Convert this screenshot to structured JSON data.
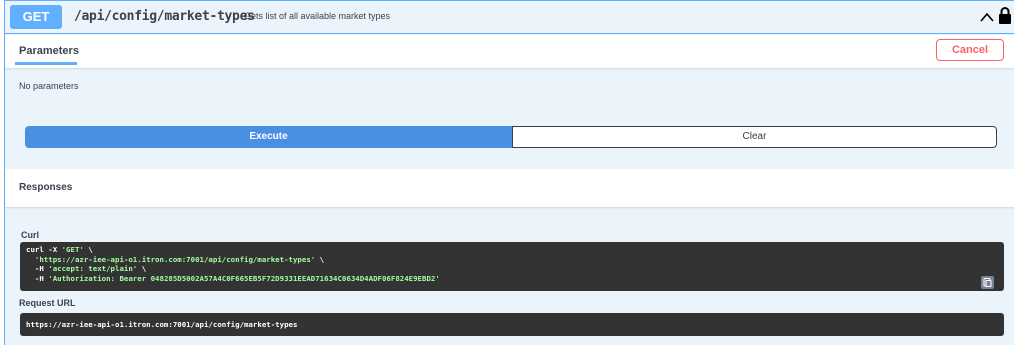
{
  "operation": {
    "method": "GET",
    "path": "/api/config/market-types",
    "description": "Gets list of all available market types",
    "colors": {
      "accent": "#61affe",
      "background": "#ebf3fb",
      "cancel": "#ff6060",
      "execute": "#4990e2"
    }
  },
  "parameters": {
    "tab_label": "Parameters",
    "cancel_label": "Cancel",
    "empty_text": "No parameters"
  },
  "actions": {
    "execute_label": "Execute",
    "clear_label": "Clear"
  },
  "responses": {
    "title": "Responses",
    "curl_label": "Curl",
    "curl": {
      "line1_cmd": "curl -X ",
      "line1_method": "'GET'",
      "line1_end": " \\",
      "line2_url": "  'https://azr-iee-api-o1.itron.com:7001/api/config/market-types'",
      "line2_end": " \\",
      "line3_flag": "  -H ",
      "line3_val": "'accept: text/plain'",
      "line3_end": " \\",
      "line4_flag": "  -H ",
      "line4_val": "'Authorization: Bearer 048285D5002A57A4C0F665EB5F72D9331EEAD71634C0634D4ADF06F824E9EBD2'"
    },
    "request_url_label": "Request URL",
    "request_url": "https://azr-iee-api-o1.itron.com:7001/api/config/market-types"
  },
  "icons": [
    "chevron-up-icon",
    "lock-icon",
    "copy-icon"
  ]
}
